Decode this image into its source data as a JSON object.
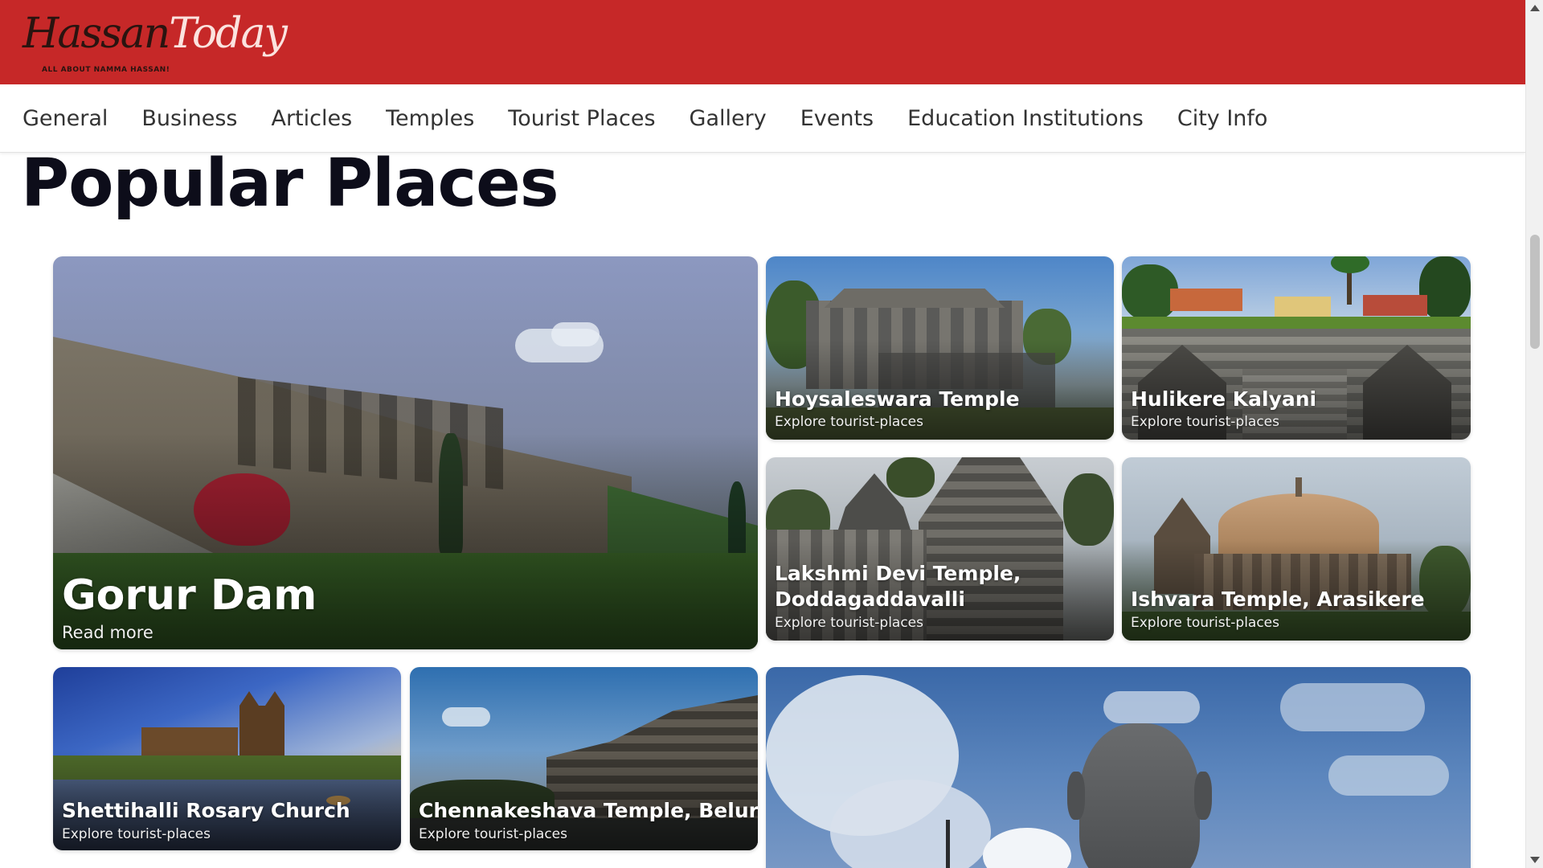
{
  "brand": {
    "name_part1": "Hassan",
    "name_part2": "Today",
    "tagline": "ALL ABOUT NAMMA HASSAN!"
  },
  "nav": {
    "items": [
      "General",
      "Business",
      "Articles",
      "Temples",
      "Tourist Places",
      "Gallery",
      "Events",
      "Education Institutions",
      "City Info"
    ]
  },
  "section": {
    "title": "Popular Places"
  },
  "cards": {
    "featured": {
      "title": "Gorur Dam",
      "subtitle": "Read more"
    },
    "hoysaleswara": {
      "title": "Hoysaleswara Temple",
      "subtitle": "Explore tourist-places"
    },
    "hulikere": {
      "title": "Hulikere Kalyani",
      "subtitle": "Explore tourist-places"
    },
    "lakshmi": {
      "title_line1": "Lakshmi Devi Temple,",
      "title_line2": "Doddagaddavalli",
      "subtitle": "Explore tourist-places"
    },
    "ishvara": {
      "title": "Ishvara Temple, Arasikere",
      "subtitle": "Explore tourist-places"
    },
    "shettihalli": {
      "title": "Shettihalli Rosary Church",
      "subtitle": "Explore tourist-places"
    },
    "chennakeshava": {
      "title": "Chennakeshava Temple, Belur",
      "subtitle": "Explore tourist-places"
    }
  },
  "colors": {
    "header_bg": "#c62828",
    "title_text": "#0d0d1a",
    "nav_text": "#333333"
  }
}
